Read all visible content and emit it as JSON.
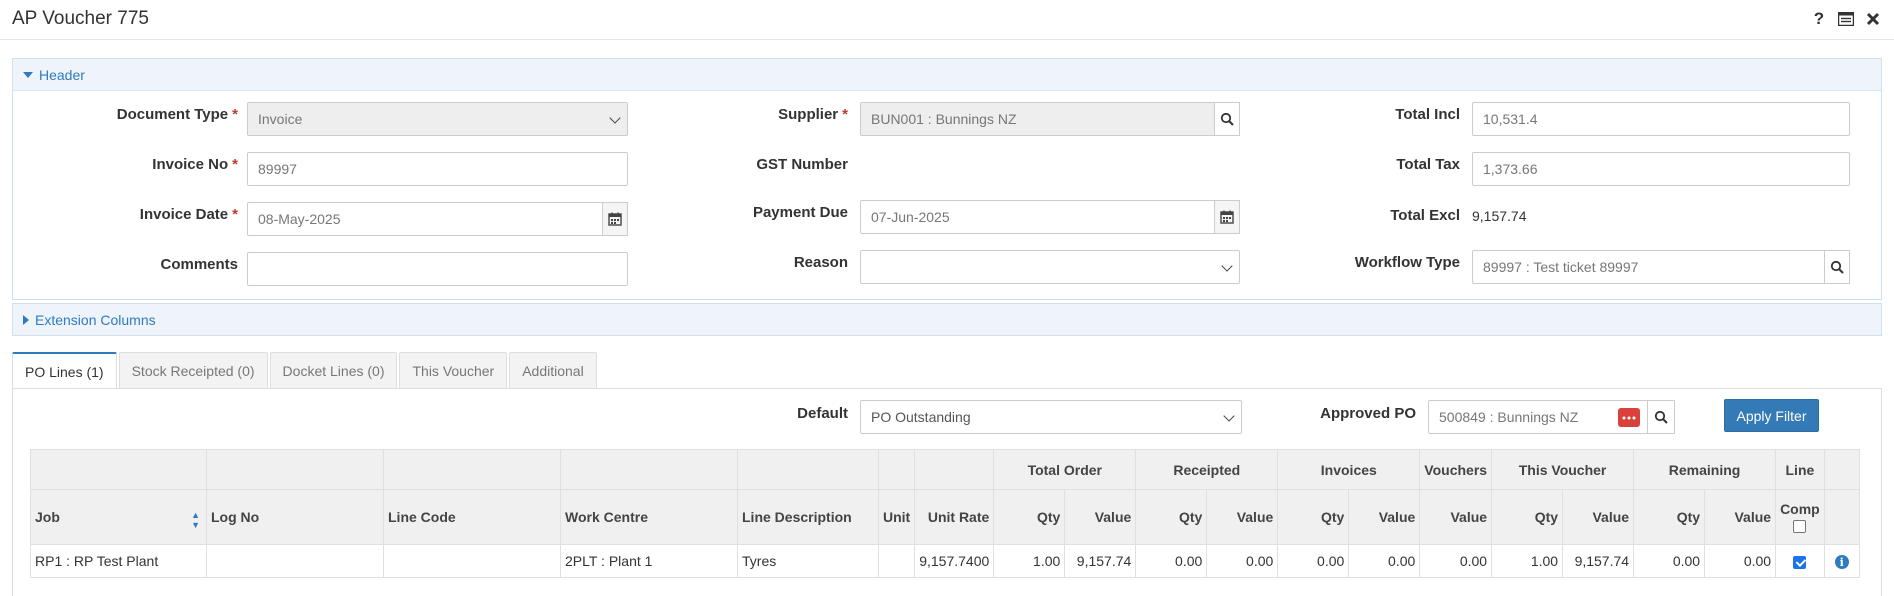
{
  "window": {
    "title": "AP Voucher 775",
    "icons": [
      "help-icon",
      "list-view-icon",
      "close-icon"
    ]
  },
  "header_panel": {
    "title": "Header",
    "document_type": {
      "label": "Document Type",
      "value": "Invoice"
    },
    "invoice_no": {
      "label": "Invoice No",
      "value": "89997"
    },
    "invoice_date": {
      "label": "Invoice Date",
      "value": "08-May-2025"
    },
    "comments": {
      "label": "Comments",
      "value": ""
    },
    "supplier": {
      "label": "Supplier",
      "value": "BUN001 : Bunnings NZ"
    },
    "gst_number": {
      "label": "GST Number",
      "value": ""
    },
    "payment_due": {
      "label": "Payment Due",
      "value": "07-Jun-2025"
    },
    "reason": {
      "label": "Reason",
      "value": ""
    },
    "total_incl": {
      "label": "Total Incl",
      "value": "10,531.4"
    },
    "total_tax": {
      "label": "Total Tax",
      "value": "1,373.66"
    },
    "total_excl": {
      "label": "Total Excl",
      "value": "9,157.74"
    },
    "workflow_type": {
      "label": "Workflow Type",
      "value": "89997 : Test ticket 89997"
    },
    "required_mark": "*"
  },
  "extension_panel": {
    "title": "Extension Columns"
  },
  "tabs": [
    {
      "label": "PO Lines (1)",
      "active": true
    },
    {
      "label": "Stock Receipted (0)",
      "active": false
    },
    {
      "label": "Docket Lines (0)",
      "active": false
    },
    {
      "label": "This Voucher",
      "active": false
    },
    {
      "label": "Additional",
      "active": false
    }
  ],
  "filter": {
    "default_label": "Default",
    "default_value": "PO Outstanding",
    "approved_po_label": "Approved PO",
    "approved_po_value": "500849 : Bunnings NZ",
    "apply_label": "Apply Filter"
  },
  "grid": {
    "group_headers": [
      "Total Order",
      "Receipted",
      "Invoices",
      "Vouchers",
      "This Voucher",
      "Remaining",
      "Line"
    ],
    "columns": [
      "Job",
      "Log No",
      "Line Code",
      "Work Centre",
      "Line Description",
      "Unit",
      "Unit Rate",
      "Qty",
      "Value",
      "Qty",
      "Value",
      "Qty",
      "Value",
      "Value",
      "Qty",
      "Value",
      "Qty",
      "Value",
      "Comp"
    ],
    "rows": [
      {
        "job": "RP1 : RP Test Plant",
        "log_no": "",
        "line_code": "",
        "work_centre": "2PLT : Plant 1",
        "line_description": "Tyres",
        "unit": "",
        "unit_rate": "9,157.7400",
        "total_order_qty": "1.00",
        "total_order_value": "9,157.74",
        "receipted_qty": "0.00",
        "receipted_value": "0.00",
        "invoices_qty": "0.00",
        "invoices_value": "0.00",
        "vouchers_value": "0.00",
        "this_voucher_qty": "1.00",
        "this_voucher_value": "9,157.74",
        "remaining_qty": "0.00",
        "remaining_value": "0.00",
        "line_comp": true
      }
    ]
  },
  "colors": {
    "accent": "#337ab7",
    "panel_header": "#eef4fa",
    "required": "#c0392b",
    "clear_button": "#d9413a"
  }
}
